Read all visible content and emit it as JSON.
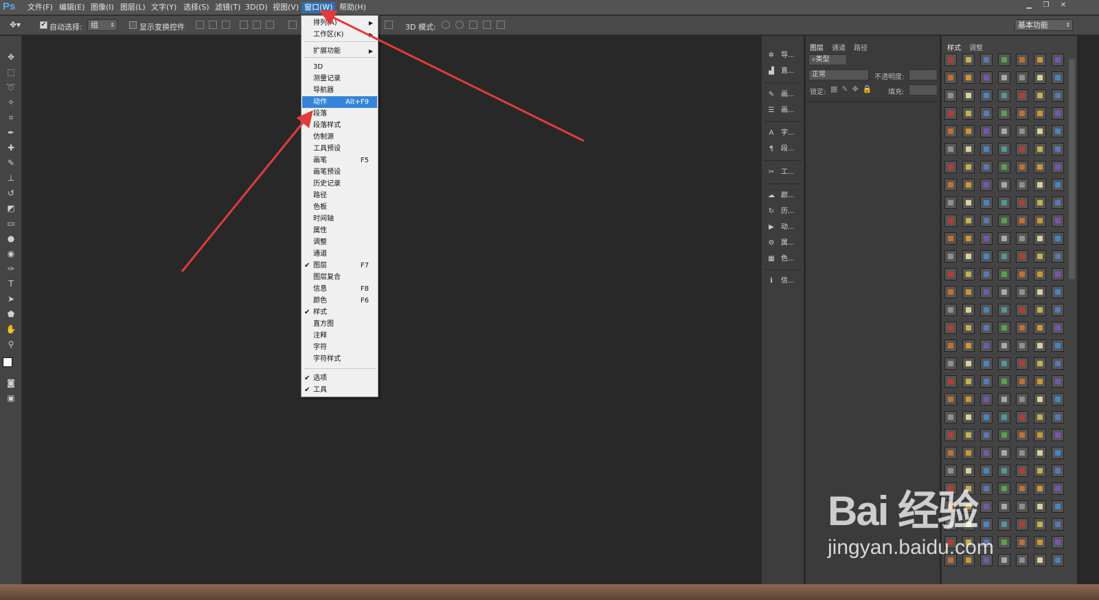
{
  "app": {
    "logo": "Ps"
  },
  "menubar": {
    "items": [
      "文件(F)",
      "编辑(E)",
      "图像(I)",
      "图层(L)",
      "文字(Y)",
      "选择(S)",
      "滤镜(T)",
      "3D(D)",
      "视图(V)",
      "窗口(W)",
      "帮助(H)"
    ],
    "active": "窗口(W)"
  },
  "window_controls": {
    "minimize": "▁",
    "restore": "❐",
    "close": "✕"
  },
  "options_bar": {
    "auto_select_label": "自动选择:",
    "auto_select_checked": true,
    "auto_select_value": "组",
    "show_transform_label": "显示变换控件",
    "show_transform_checked": false,
    "mode_3d_label": "3D 模式:",
    "workspace_value": "基本功能"
  },
  "window_menu": {
    "items": [
      {
        "label": "排列(A)",
        "shortcut": "",
        "checked": false,
        "submenu": true
      },
      {
        "label": "工作区(K)",
        "shortcut": "",
        "checked": false,
        "submenu": true
      },
      {
        "label": "扩展功能",
        "shortcut": "",
        "checked": false,
        "submenu": true
      },
      {
        "label": "3D",
        "shortcut": "",
        "checked": false
      },
      {
        "label": "测量记录",
        "shortcut": "",
        "checked": false
      },
      {
        "label": "导航器",
        "shortcut": "",
        "checked": false
      },
      {
        "label": "动作",
        "shortcut": "Alt+F9",
        "checked": false,
        "highlighted": true
      },
      {
        "label": "段落",
        "shortcut": "",
        "checked": false
      },
      {
        "label": "段落样式",
        "shortcut": "",
        "checked": false
      },
      {
        "label": "仿制源",
        "shortcut": "",
        "checked": false
      },
      {
        "label": "工具预设",
        "shortcut": "",
        "checked": false
      },
      {
        "label": "画笔",
        "shortcut": "F5",
        "checked": false
      },
      {
        "label": "画笔预设",
        "shortcut": "",
        "checked": false
      },
      {
        "label": "历史记录",
        "shortcut": "",
        "checked": false
      },
      {
        "label": "路径",
        "shortcut": "",
        "checked": false
      },
      {
        "label": "色板",
        "shortcut": "",
        "checked": false
      },
      {
        "label": "时间轴",
        "shortcut": "",
        "checked": false
      },
      {
        "label": "属性",
        "shortcut": "",
        "checked": false
      },
      {
        "label": "调整",
        "shortcut": "",
        "checked": false
      },
      {
        "label": "通道",
        "shortcut": "",
        "checked": false
      },
      {
        "label": "图层",
        "shortcut": "F7",
        "checked": true
      },
      {
        "label": "图层复合",
        "shortcut": "",
        "checked": false
      },
      {
        "label": "信息",
        "shortcut": "F8",
        "checked": false
      },
      {
        "label": "颜色",
        "shortcut": "F6",
        "checked": false
      },
      {
        "label": "样式",
        "shortcut": "",
        "checked": true
      },
      {
        "label": "直方图",
        "shortcut": "",
        "checked": false
      },
      {
        "label": "注释",
        "shortcut": "",
        "checked": false
      },
      {
        "label": "字符",
        "shortcut": "",
        "checked": false
      },
      {
        "label": "字符样式",
        "shortcut": "",
        "checked": false
      },
      {
        "label": "选项",
        "shortcut": "",
        "checked": true
      },
      {
        "label": "工具",
        "shortcut": "",
        "checked": true
      }
    ]
  },
  "dock": {
    "items": [
      {
        "icon": "navigator-icon",
        "glyph": "✲",
        "label": "导..."
      },
      {
        "icon": "histogram-icon",
        "glyph": "▟",
        "label": "直..."
      },
      {
        "icon": "brush-icon",
        "glyph": "✎",
        "label": "画..."
      },
      {
        "icon": "adjust-icon",
        "glyph": "☰",
        "label": "画..."
      },
      {
        "icon": "character-icon",
        "glyph": "A",
        "label": "字..."
      },
      {
        "icon": "paragraph-icon",
        "glyph": "¶",
        "label": "段..."
      },
      {
        "icon": "tools-icon",
        "glyph": "✂",
        "label": "工..."
      },
      {
        "icon": "3d-icon",
        "glyph": "☁",
        "label": "颜..."
      },
      {
        "icon": "history-icon",
        "glyph": "↻",
        "label": "历..."
      },
      {
        "icon": "actions-icon",
        "glyph": "▶",
        "label": "动..."
      },
      {
        "icon": "properties-icon",
        "glyph": "⚙",
        "label": "属..."
      },
      {
        "icon": "swatches-icon",
        "glyph": "▦",
        "label": "色..."
      },
      {
        "icon": "info-icon",
        "glyph": "ℹ",
        "label": "信..."
      }
    ]
  },
  "layers_panel": {
    "tabs": [
      "图层",
      "通道",
      "路径"
    ],
    "kind_label": "类型",
    "blend_mode": "正常",
    "opacity_label": "不透明度:",
    "lock_label": "锁定:",
    "fill_label": "填充:"
  },
  "styles_panel": {
    "tabs": [
      "样式",
      "调整"
    ]
  },
  "watermark": {
    "brand": "Bai 经验",
    "url": "jingyan.baidu.com"
  },
  "colors": {
    "accent": "#3584d9",
    "arrow": "#e23b3b",
    "swatches": [
      "#c8382e",
      "#e8a02a",
      "#3f8fd6",
      "#58b04a",
      "#9a9a9a",
      "#d6c34a",
      "#7c56c2",
      "#4fa6a2",
      "#d4742c",
      "#f2e6a4",
      "#5a7fc8",
      "#b8b8b8"
    ]
  }
}
